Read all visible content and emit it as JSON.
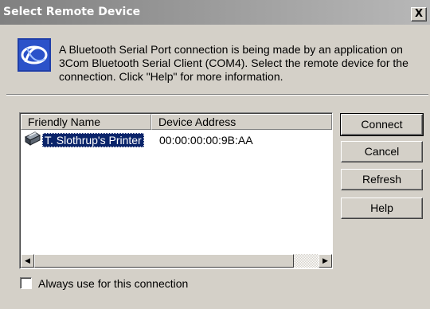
{
  "dialog": {
    "title": "Select Remote Device",
    "close_label": "X",
    "description": "A Bluetooth Serial Port connection is being made by an application on\n3Com Bluetooth Serial Client (COM4).  Select the remote device for the\nconnection.  Click \"Help\" for more information.",
    "icon": "bluetooth-icon"
  },
  "device_list": {
    "columns": [
      "Friendly Name",
      "Device Address"
    ],
    "rows": [
      {
        "name": "T. Slothrup's Printer",
        "address": "00:00:00:00:9B:AA",
        "icon": "printer-icon",
        "selected": true
      }
    ]
  },
  "buttons": {
    "connect": "Connect",
    "cancel": "Cancel",
    "refresh": "Refresh",
    "help": "Help"
  },
  "checkbox": {
    "label": "Always use for this connection",
    "checked": false
  },
  "colors": {
    "selection": "#0a246a",
    "title_gradient_start": "#808080",
    "title_gradient_end": "#b8b8b8",
    "face": "#d4d0c8"
  }
}
